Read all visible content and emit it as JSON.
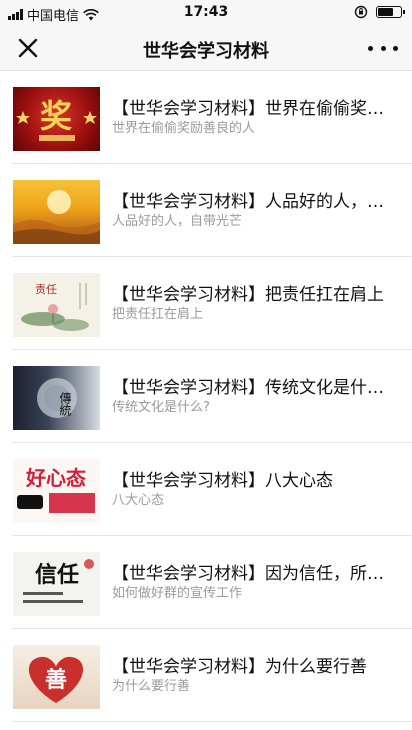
{
  "status_bar": {
    "carrier": "中国电信",
    "time": "17:43",
    "battery_level": 0.7
  },
  "nav": {
    "title": "世华会学习材料",
    "close_icon": "close-icon",
    "more_icon": "more-icon"
  },
  "articles": [
    {
      "title": "【世华会学习材料】世界在偷偷奖励善良的人",
      "subtitle": "世界在偷偷奖励善良的人",
      "thumb_text": "奖"
    },
    {
      "title": "【世华会学习材料】人品好的人，自带光芒",
      "subtitle": "人品好的人，自带光芒",
      "thumb_text": ""
    },
    {
      "title": "【世华会学习材料】把责任扛在肩上",
      "subtitle": "把责任扛在肩上",
      "thumb_text": "责任"
    },
    {
      "title": "【世华会学习材料】传统文化是什么？",
      "subtitle": "传统文化是什么?",
      "thumb_text": "傳統"
    },
    {
      "title": "【世华会学习材料】八大心态",
      "subtitle": "八大心态",
      "thumb_text": "好心态"
    },
    {
      "title": "【世华会学习材料】因为信任，所以简单",
      "subtitle": "如何做好群的宣传工作",
      "thumb_text": "信任"
    },
    {
      "title": "【世华会学习材料】为什么要行善",
      "subtitle": "为什么要行善",
      "thumb_text": "善"
    }
  ],
  "colors": {
    "nav_background": "#f7f7f7",
    "title_text": "#111111",
    "subtitle_text": "#9a9a9a",
    "divider": "#e6e6e6"
  }
}
